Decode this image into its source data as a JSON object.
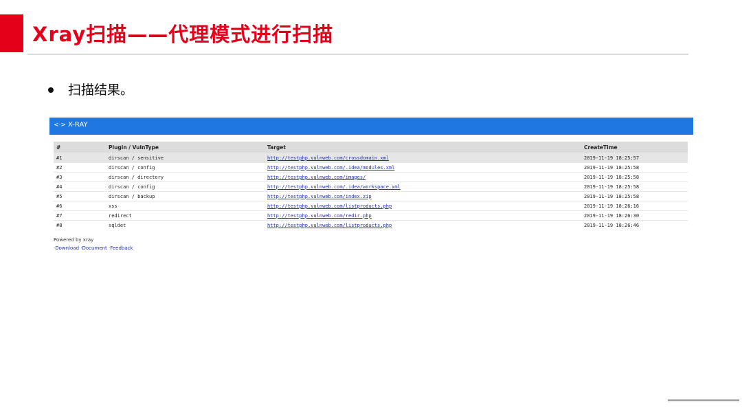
{
  "slide": {
    "title": "Xray扫描——代理模式进行扫描",
    "bullet": "扫描结果。"
  },
  "colors": {
    "accent": "#e5001a",
    "report_header": "#1f78e0",
    "link": "#1f2fa8"
  },
  "report": {
    "logo_icon": "code-brackets-icon",
    "logo_mark": "<·>",
    "logo_text": "X-RAY",
    "table": {
      "headers": [
        "#",
        "Plugin / VulnType",
        "Target",
        "CreateTime"
      ],
      "rows": [
        [
          "#1",
          "dirscan / sensitive",
          "http://testphp.vulnweb.com/crossdomain.xml",
          "2019-11-19 18:25:57"
        ],
        [
          "#2",
          "dirscan / config",
          "http://testphp.vulnweb.com/.idea/modules.xml",
          "2019-11-19 18:25:58"
        ],
        [
          "#3",
          "dirscan / directory",
          "http://testphp.vulnweb.com/images/",
          "2019-11-19 18:25:58"
        ],
        [
          "#4",
          "dirscan / config",
          "http://testphp.vulnweb.com/.idea/workspace.xml",
          "2019-11-19 18:25:58"
        ],
        [
          "#5",
          "dirscan / backup",
          "http://testphp.vulnweb.com/index.zip",
          "2019-11-19 18:25:58"
        ],
        [
          "#6",
          "xss",
          "http://testphp.vulnweb.com/listproducts.php",
          "2019-11-19 18:26:16"
        ],
        [
          "#7",
          "redirect",
          "http://testphp.vulnweb.com/redir.php",
          "2019-11-19 18:26:30"
        ],
        [
          "#8",
          "sqldet",
          "http://testphp.vulnweb.com/listproducts.php",
          "2019-11-19 18:26:46"
        ]
      ]
    },
    "footer": {
      "powered_by": "Powered by xray",
      "links": [
        "·Download",
        "·Document",
        "·Feedback"
      ]
    }
  }
}
